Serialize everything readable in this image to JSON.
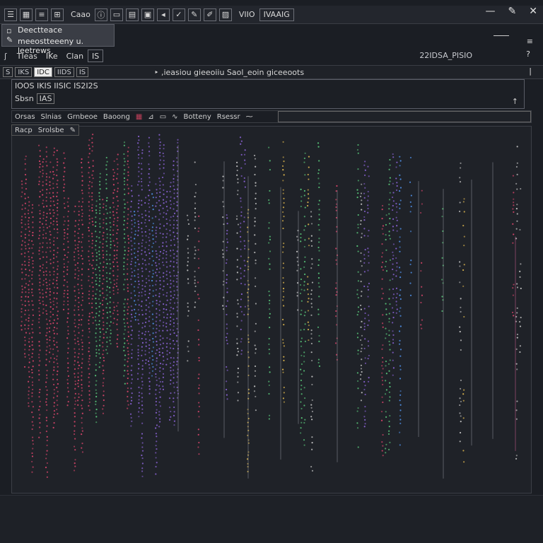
{
  "toolbar": {
    "label_1": "Caao",
    "label_2": "VIIO",
    "label_3": "IVAAIG"
  },
  "panel": {
    "title": "Deectteace",
    "subtitle": "meeostteeeny u. leetrews"
  },
  "row2": {
    "labels": [
      "TIeas",
      "IKe",
      "Clan"
    ],
    "number": "IS",
    "right": "22IDSA_PISIO"
  },
  "row3": {
    "boxes": [
      "S",
      "IKS",
      "IDC",
      "IIDS",
      "IS"
    ],
    "text": "‣ ,ieasiou  gieeoiiu   Saol_eoin giceeoots"
  },
  "info": {
    "line1": "IOOS  IKIS  IISIC IS2I2S",
    "line2": "Sbsn",
    "line2_box": "IAS",
    "right_mark": "↑"
  },
  "tool": {
    "items": [
      "Orsas",
      "Slnias",
      "Grnbeoe",
      "Baoong",
      "Botteny",
      "Rsessr"
    ]
  },
  "tool2": {
    "items": [
      "Racp",
      "Srolsbe"
    ]
  },
  "plot": {
    "colors": [
      "#d9456b",
      "#4f8fe6",
      "#59c77a",
      "#8b63d6",
      "#e0b84e",
      "#c6c6c6"
    ]
  }
}
